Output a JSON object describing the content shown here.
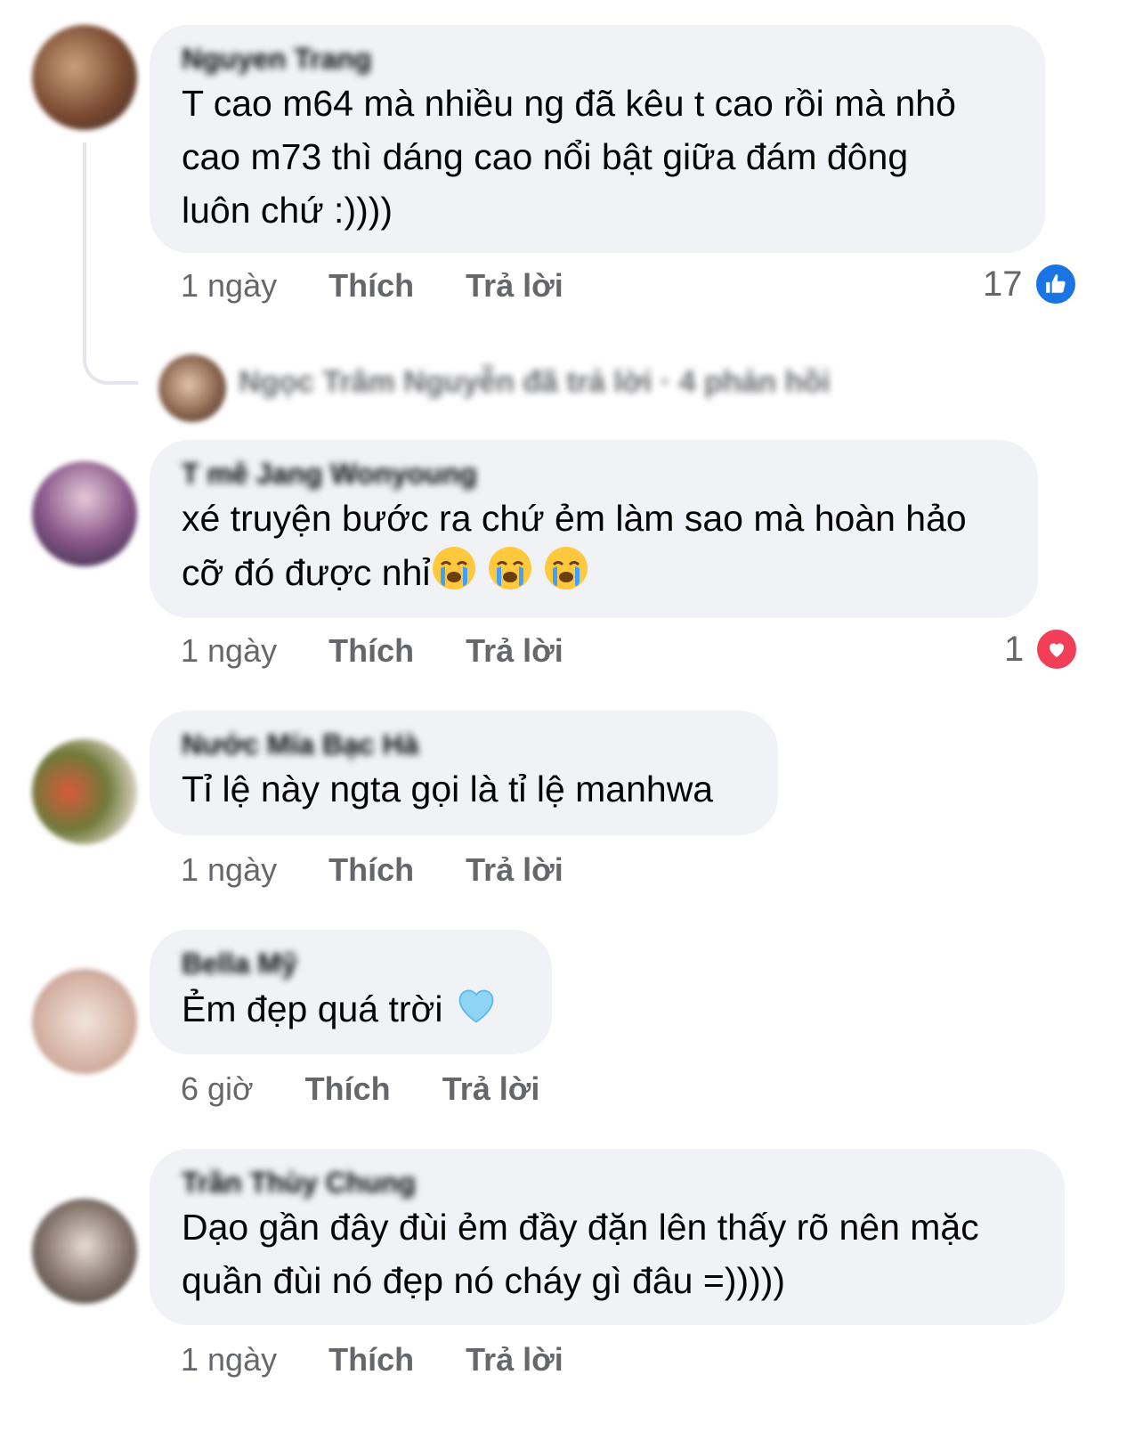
{
  "comments": [
    {
      "author": "Nguyen Trang",
      "lines": [
        "T cao m64 mà nhiều ng đã kêu t cao rồi mà nhỏ",
        "cao m73 thì dáng cao nổi bật giữa đám đông",
        "luôn chứ :))))"
      ],
      "time": "1 ngày",
      "like_label": "Thích",
      "reply_label": "Trả lời",
      "reaction_count": "17",
      "reaction_icon": "like-icon"
    },
    {
      "author": "T mê Jang Wonyoung",
      "lines": [
        "xé truyện bước ra chứ ẻm làm sao mà hoàn hảo",
        "cỡ đó được nhỉ"
      ],
      "emojis": [
        "crying-face-icon",
        "crying-face-icon",
        "crying-face-icon"
      ],
      "time": "1 ngày",
      "like_label": "Thích",
      "reply_label": "Trả lời",
      "reaction_count": "1",
      "reaction_icon": "heart-icon"
    },
    {
      "author": "Nước Mía Bạc Hà",
      "lines": [
        "Tỉ lệ này ngta gọi là tỉ lệ manhwa"
      ],
      "time": "1 ngày",
      "like_label": "Thích",
      "reply_label": "Trả lời"
    },
    {
      "author": "Bella Mỹ",
      "lines": [
        "Ẻm đẹp quá trời"
      ],
      "emojis": [
        "light-blue-heart-icon"
      ],
      "time": "6 giờ",
      "like_label": "Thích",
      "reply_label": "Trả lời"
    },
    {
      "author": "Trần Thùy Chung",
      "lines": [
        "Dạo gần đây đùi ẻm đầy đặn lên thấy rõ nên mặc",
        "quần đùi nó đẹp nó cháy gì đâu =)))))"
      ],
      "time": "1 ngày",
      "like_label": "Thích",
      "reply_label": "Trả lời"
    }
  ],
  "reply_summary": {
    "text": "Ngọc Trâm Nguyễn đã trả lời · 4 phản hồi"
  },
  "colors": {
    "bubble": "#f0f2f5",
    "secondary_text": "#65676b",
    "like_blue": "#1b74e4",
    "love_red": "#f33e58"
  }
}
